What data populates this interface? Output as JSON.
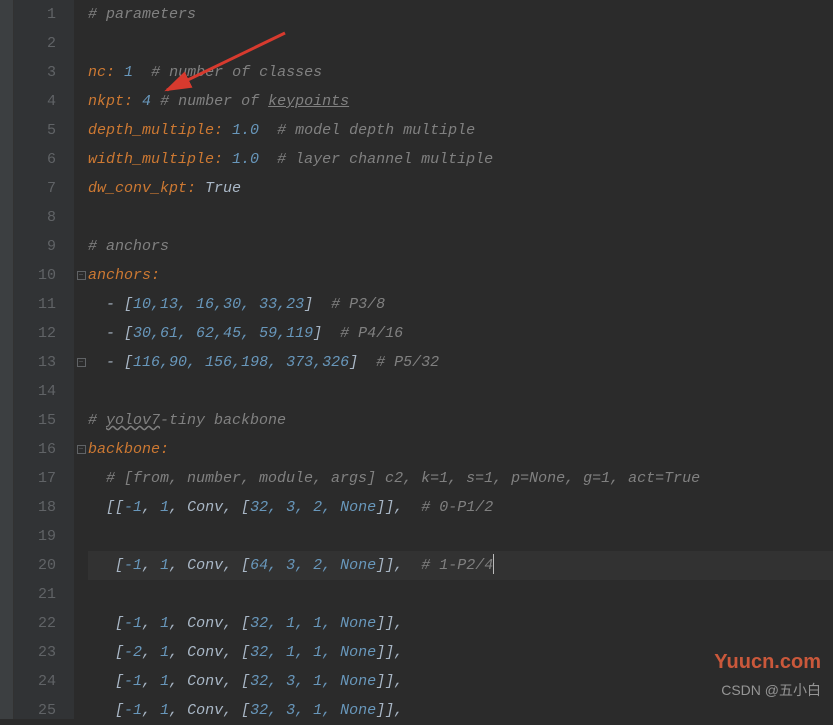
{
  "gutter": {
    "lines": [
      "1",
      "2",
      "3",
      "4",
      "5",
      "6",
      "7",
      "8",
      "9",
      "10",
      "11",
      "12",
      "13",
      "14",
      "15",
      "16",
      "17",
      "18",
      "19",
      "20",
      "21",
      "22",
      "23",
      "24",
      "25"
    ]
  },
  "code": {
    "l1_comment": "# parameters",
    "l3_key": "nc",
    "l3_val": "1",
    "l3_comment": "# number of classes",
    "l4_key": "nkpt",
    "l4_val": "4",
    "l4_comment_pre": "# number of ",
    "l4_comment_kp": "keypoints",
    "l5_key": "depth_multiple",
    "l5_val": "1.0",
    "l5_comment": "# model depth multiple",
    "l6_key": "width_multiple",
    "l6_val": "1.0",
    "l6_comment": "# layer channel multiple",
    "l7_key": "dw_conv_kpt",
    "l7_val": "True",
    "l9_comment": "# anchors",
    "l10_key": "anchors",
    "l11_arr": "10,13, 16,30, 33,23",
    "l11_comment": "# P3/8",
    "l12_arr": "30,61, 62,45, 59,119",
    "l12_comment": "# P4/16",
    "l13_arr": "116,90, 156,198, 373,326",
    "l13_comment": "# P5/32",
    "l15_comment_pre": "# ",
    "l15_comment_wavy": "yolov7",
    "l15_comment_post": "-tiny backbone",
    "l16_key": "backbone",
    "l17_comment": "# [from, number, module, args] c2, k=1, s=1, p=None, g=1, act=True",
    "l18_open": "[[",
    "l18_n1": "-1",
    "l18_n2": "1",
    "l18_conv": "Conv",
    "l18_inner": "32, 3, 2, None",
    "l18_close": "]],  ",
    "l18_comment": "# 0-P1/2",
    "l20_open": " [",
    "l20_n1": "-1",
    "l20_n2": "1",
    "l20_conv": "Conv",
    "l20_inner": "64, 3, 2, None",
    "l20_close": "]],  ",
    "l20_comment": "# 1-P2/4",
    "l22_open": " [",
    "l22_n1": "-1",
    "l22_n2": "1",
    "l22_conv": "Conv",
    "l22_inner": "32, 1, 1, None",
    "l22_close": "]],",
    "l23_open": " [",
    "l23_n1": "-2",
    "l23_n2": "1",
    "l23_conv": "Conv",
    "l23_inner": "32, 1, 1, None",
    "l23_close": "]],",
    "l24_open": " [",
    "l24_n1": "-1",
    "l24_n2": "1",
    "l24_conv": "Conv",
    "l24_inner": "32, 3, 1, None",
    "l24_close": "]],",
    "l25_open": " [",
    "l25_n1": "-1",
    "l25_n2": "1",
    "l25_conv": "Conv",
    "l25_inner": "32, 3, 1, None",
    "l25_close": "]],"
  },
  "watermarks": {
    "w1": "Yuucn.com",
    "w2": "CSDN @五小白"
  },
  "annotation": {
    "arrow_target": "nkpt value on line 4"
  }
}
